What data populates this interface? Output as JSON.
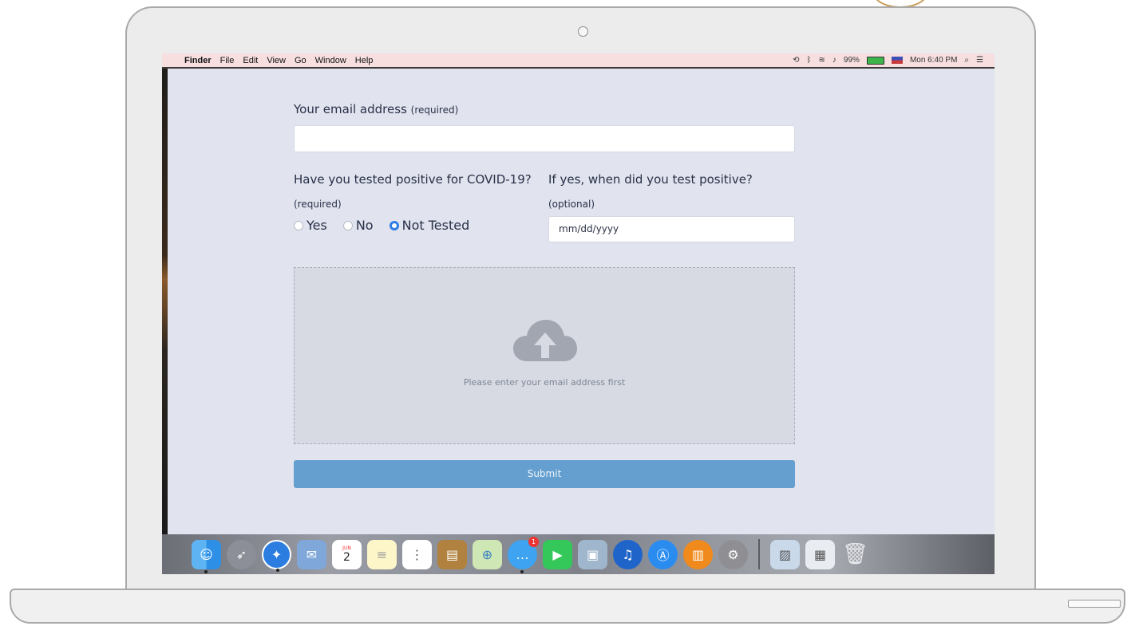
{
  "menubar": {
    "apple": "",
    "items": [
      "Finder",
      "File",
      "Edit",
      "View",
      "Go",
      "Window",
      "Help"
    ],
    "battery": "99%",
    "battery_level": 0.99,
    "clock": "Mon 6:40 PM",
    "status_icons": [
      "time-machine-icon",
      "bluetooth-icon",
      "wifi-icon",
      "volume-icon",
      "battery-icon",
      "flag-icon",
      "spotlight-icon",
      "notification-center-icon"
    ]
  },
  "form": {
    "email_label": "Your email address",
    "email_required": "(required)",
    "email_value": "",
    "covid_question": "Have you tested positive for COVID-19?",
    "covid_required": "(required)",
    "date_question": "If yes, when did you test positive?",
    "date_optional": "(optional)",
    "radio_options": [
      "Yes",
      "No",
      "Not Tested"
    ],
    "radio_selected": "Not Tested",
    "date_placeholder": "mm/dd/yyyy",
    "upload_hint": "Please enter your email address first",
    "submit_label": "Submit"
  },
  "dock": {
    "apps": [
      "finder",
      "launchpad",
      "safari",
      "mail",
      "calendar",
      "notes",
      "reminders",
      "contacts",
      "maps",
      "messages",
      "facetime",
      "preview",
      "itunes",
      "app-store",
      "ibooks",
      "system-preferences",
      "photos",
      "screenshot",
      "trash"
    ],
    "calendar_month": "JUN",
    "calendar_day": "2",
    "messages_badge": "1"
  },
  "colors": {
    "accent": "#2e7ee6",
    "submit_bg": "#649fcf",
    "screen_bg": "#e1e4ee"
  }
}
